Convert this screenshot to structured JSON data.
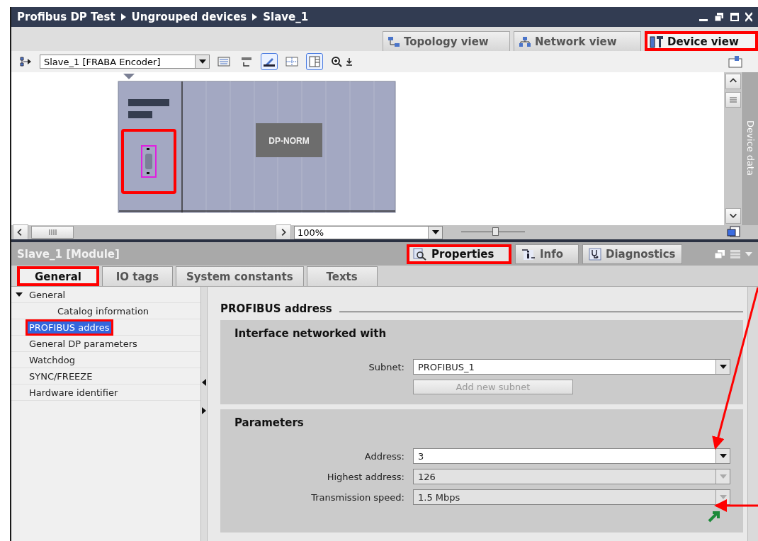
{
  "breadcrumb": [
    "Profibus DP Test",
    "Ungrouped devices",
    "Slave_1"
  ],
  "view_tabs": [
    {
      "kind": "topology",
      "label": "Topology view",
      "selected": false,
      "highlighted": false
    },
    {
      "kind": "network",
      "label": "Network view",
      "selected": false,
      "highlighted": false
    },
    {
      "kind": "device",
      "label": "Device view",
      "selected": true,
      "highlighted": true
    }
  ],
  "device_select": {
    "value": "Slave_1 [FRABA Encoder]"
  },
  "canvas": {
    "module_label": "DP-NORM",
    "interface_highlighted": true,
    "side_panel_label": "Device data",
    "zoom": "100%",
    "zoom_slider": {
      "level": 0.53
    }
  },
  "inspector": {
    "title": "Slave_1 [Module]",
    "tabs": [
      {
        "kind": "properties",
        "label": "Properties",
        "selected": true,
        "highlighted": true
      },
      {
        "kind": "info",
        "label": "Info",
        "selected": false,
        "highlighted": false
      },
      {
        "kind": "diagnostics",
        "label": "Diagnostics",
        "selected": false,
        "highlighted": false
      }
    ],
    "subtabs": [
      {
        "label": "General",
        "selected": true,
        "highlighted": true
      },
      {
        "label": "IO tags",
        "selected": false,
        "highlighted": false
      },
      {
        "label": "System constants",
        "selected": false,
        "highlighted": false
      },
      {
        "label": "Texts",
        "selected": false,
        "highlighted": false
      }
    ],
    "nav": [
      {
        "label": "General",
        "expanded": true,
        "selected": false,
        "highlighted": false,
        "children": [
          {
            "label": "Catalog information",
            "selected": false,
            "highlighted": false
          }
        ]
      },
      {
        "label": "PROFIBUS addres",
        "selected": true,
        "highlighted": true
      },
      {
        "label": "General DP parameters",
        "selected": false,
        "highlighted": false
      },
      {
        "label": "Watchdog",
        "selected": false,
        "highlighted": false
      },
      {
        "label": "SYNC/FREEZE",
        "selected": false,
        "highlighted": false
      },
      {
        "label": "Hardware identifier",
        "selected": false,
        "highlighted": false
      }
    ],
    "heading": "PROFIBUS address",
    "sections": [
      {
        "title": "Interface networked with",
        "fields": [
          {
            "label": "Subnet:",
            "value": "PROFIBUS_1",
            "disabled": false
          }
        ],
        "button": {
          "label": "Add new subnet",
          "disabled": true
        }
      },
      {
        "title": "Parameters",
        "fields": [
          {
            "label": "Address:",
            "value": "3",
            "disabled": false
          },
          {
            "label": "Highest address:",
            "value": "126",
            "disabled": true
          },
          {
            "label": "Transmission speed:",
            "value": "1.5 Mbps",
            "disabled": true
          }
        ],
        "go_to_link": true
      }
    ]
  }
}
